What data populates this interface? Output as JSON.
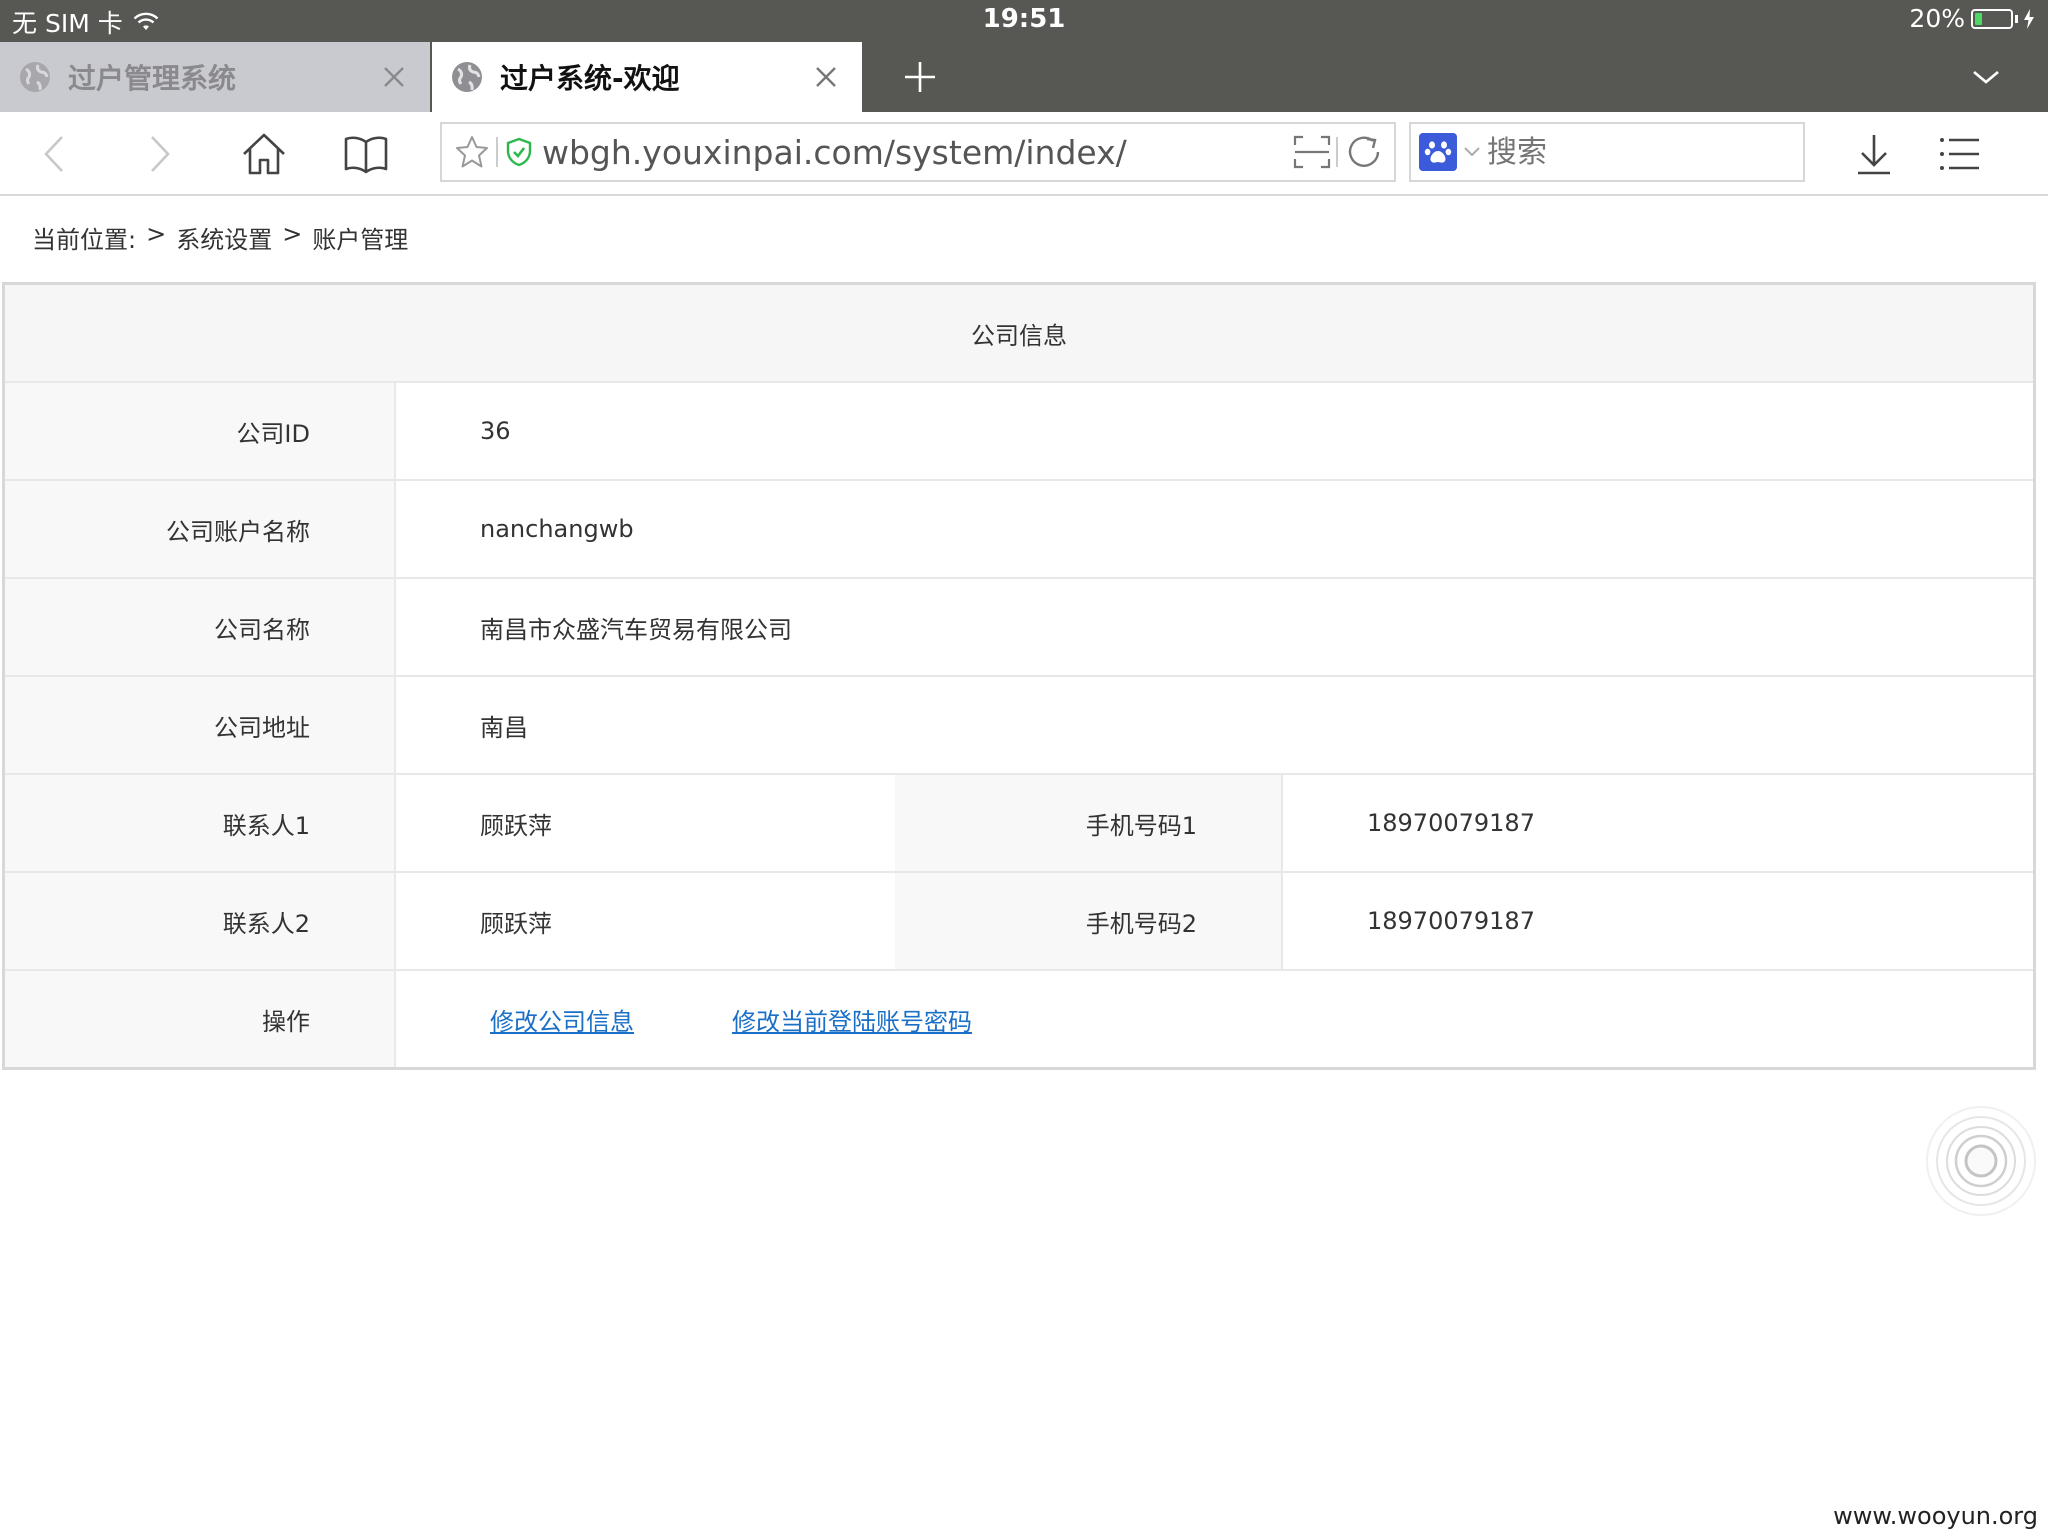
{
  "status_bar": {
    "carrier": "无 SIM 卡",
    "time": "19:51",
    "battery": "20%",
    "battery_level": 0.2
  },
  "tabs": [
    {
      "title": "过户管理系统",
      "active": false
    },
    {
      "title": "过户系统-欢迎",
      "active": true
    }
  ],
  "toolbar": {
    "url": "wbgh.youxinpai.com/system/index/",
    "search_placeholder": "搜索"
  },
  "breadcrumb": {
    "prefix": "当前位置:",
    "sep": ">",
    "level1": "系统设置",
    "level2": "账户管理"
  },
  "company": {
    "title": "公司信息",
    "id_label": "公司ID",
    "id_value": "36",
    "account_label": "公司账户名称",
    "account_value": "nanchangwb",
    "name_label": "公司名称",
    "name_value": "南昌市众盛汽车贸易有限公司",
    "address_label": "公司地址",
    "address_value": "南昌",
    "contact1_label": "联系人1",
    "contact1_value": "顾跃萍",
    "phone1_label": "手机号码1",
    "phone1_value": "18970079187",
    "contact2_label": "联系人2",
    "contact2_value": "顾跃萍",
    "phone2_label": "手机号码2",
    "phone2_value": "18970079187",
    "action_label": "操作",
    "edit_info_link": "修改公司信息",
    "change_password_link": "修改当前登陆账号密码"
  },
  "watermark": "www.wooyun.org",
  "colors": {
    "chrome": "#575753",
    "link": "#1a6fc7",
    "secure": "#2db84d",
    "baidu": "#3b5bdb"
  }
}
